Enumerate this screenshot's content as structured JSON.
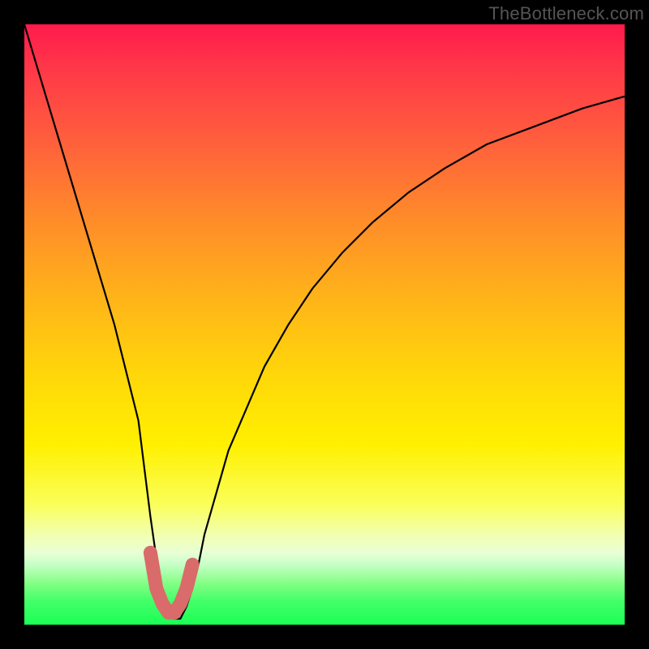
{
  "watermark": "TheBottleneck.com",
  "chart_data": {
    "type": "line",
    "title": "",
    "xlabel": "",
    "ylabel": "",
    "xlim": [
      0,
      100
    ],
    "ylim": [
      0,
      100
    ],
    "series": [
      {
        "name": "bottleneck-curve",
        "x": [
          0,
          3,
          6,
          9,
          12,
          15,
          17,
          19,
          20,
          21,
          22,
          23,
          24,
          25,
          26,
          27,
          28,
          29,
          30,
          32,
          34,
          37,
          40,
          44,
          48,
          53,
          58,
          64,
          70,
          77,
          85,
          93,
          100
        ],
        "values": [
          100,
          90,
          80,
          70,
          60,
          50,
          42,
          34,
          26,
          18,
          11,
          6,
          3,
          1,
          1,
          3,
          6,
          10,
          15,
          22,
          29,
          36,
          43,
          50,
          56,
          62,
          67,
          72,
          76,
          80,
          83,
          86,
          88
        ]
      }
    ],
    "pink_segment": {
      "name": "highlighted-minimum",
      "x": [
        21,
        22,
        23,
        24,
        25,
        26,
        27,
        28
      ],
      "values": [
        12,
        6,
        3.5,
        2,
        2,
        3.5,
        6,
        10
      ]
    },
    "colors": {
      "curve": "#000000",
      "pink": "#d96b6b",
      "gradient_top": "#ff1a4d",
      "gradient_mid": "#fff000",
      "gradient_bottom": "#1aff55"
    }
  }
}
